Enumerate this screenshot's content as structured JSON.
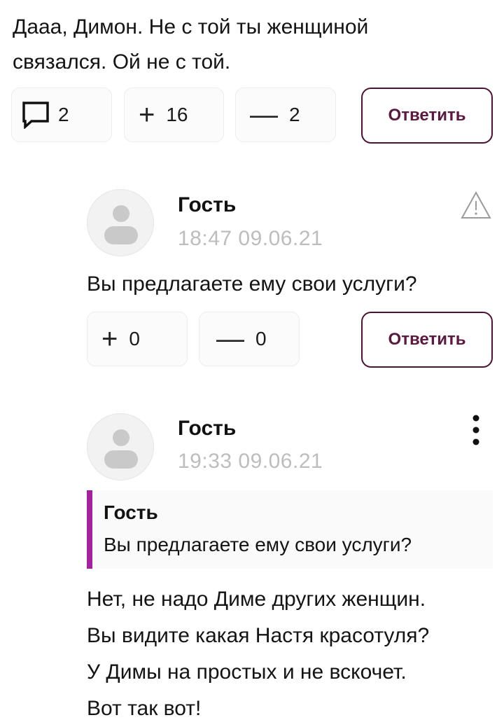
{
  "top_comment": {
    "text_line1": "Дааа, Димон. Не с той ты женщиной",
    "text_line2": "связался. Ой не с той.",
    "comments_count": "2",
    "plus_count": "16",
    "minus_count": "2",
    "reply_label": "Ответить"
  },
  "reply1": {
    "author": "Гость",
    "time": "18:47 09.06.21",
    "text": "Вы предлагаете ему свои услуги?",
    "plus_count": "0",
    "minus_count": "0",
    "reply_label": "Ответить"
  },
  "reply2": {
    "author": "Гость",
    "time": "19:33 09.06.21",
    "quote_author": "Гость",
    "quote_text": "Вы предлагаете ему свои услуги?",
    "lines": [
      "Нет, не надо Диме других женщин.",
      "Вы видите какая Настя красотуля?",
      "У Димы на простых и не вскочет.",
      "Вот так вот!"
    ]
  },
  "icons": {
    "comments": "speech-bubble-icon",
    "plus": "plus-icon",
    "minus": "minus-icon",
    "report": "warning-triangle-icon",
    "more": "vertical-dots-icon"
  }
}
